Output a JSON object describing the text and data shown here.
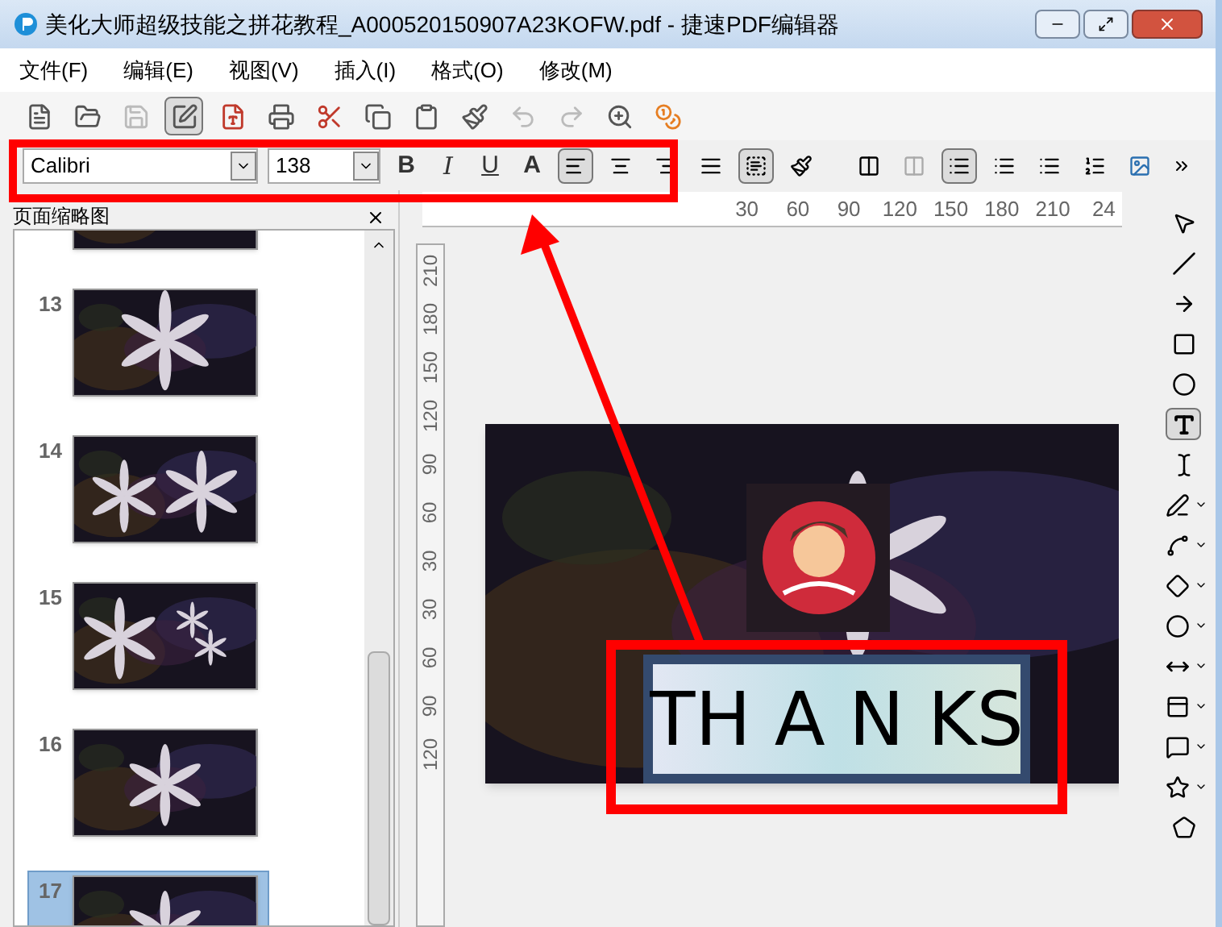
{
  "window": {
    "title": "美化大师超级技能之拼花教程_A000520150907A23KOFW.pdf - 捷速PDF编辑器"
  },
  "menu": [
    "文件(F)",
    "编辑(E)",
    "视图(V)",
    "插入(I)",
    "格式(O)",
    "修改(M)"
  ],
  "toolbar": [
    {
      "kind": "new",
      "disabled": false,
      "selected": false
    },
    {
      "kind": "open",
      "disabled": false,
      "selected": false
    },
    {
      "kind": "save",
      "disabled": true,
      "selected": false
    },
    {
      "kind": "edit",
      "disabled": false,
      "selected": true
    },
    {
      "kind": "pdf",
      "disabled": false,
      "selected": false
    },
    {
      "kind": "print",
      "disabled": false,
      "selected": false
    },
    {
      "kind": "cut",
      "disabled": false,
      "selected": false
    },
    {
      "kind": "copy",
      "disabled": false,
      "selected": false
    },
    {
      "kind": "paste",
      "disabled": false,
      "selected": false
    },
    {
      "kind": "brush",
      "disabled": false,
      "selected": false
    },
    {
      "kind": "undo",
      "disabled": true,
      "selected": false
    },
    {
      "kind": "redo",
      "disabled": true,
      "selected": false
    },
    {
      "kind": "zoom",
      "disabled": false,
      "selected": false
    },
    {
      "kind": "buy",
      "disabled": false,
      "selected": false
    }
  ],
  "format_toolbar": {
    "font": "Calibri",
    "size": "138",
    "styles": [
      "B",
      "I",
      "U",
      "A"
    ],
    "align": [
      {
        "selected": true
      },
      {
        "selected": false
      },
      {
        "selected": false
      },
      {
        "selected": false
      }
    ],
    "text_tools": [
      {
        "selected": true
      },
      {
        "selected": false
      }
    ],
    "list_tools": [
      {
        "selected": true
      },
      {
        "selected": false
      },
      {
        "selected": false
      }
    ]
  },
  "thumbnail_panel": {
    "title": "页面缩略图",
    "pages": [
      {
        "selected": false
      },
      {
        "number": "13",
        "selected": false
      },
      {
        "number": "14",
        "selected": false
      },
      {
        "number": "15",
        "selected": false
      },
      {
        "number": "16",
        "selected": false
      },
      {
        "number": "17",
        "selected": true
      }
    ]
  },
  "ruler": {
    "horizontal": [
      "30",
      "60",
      "90",
      "120",
      "150",
      "180",
      "210",
      "24"
    ],
    "vertical": [
      "210",
      "180",
      "150",
      "120",
      "90",
      "60",
      "30",
      "30",
      "60",
      "90",
      "120"
    ]
  },
  "slide": {
    "kind": "picture",
    "text": "TH A N KS"
  },
  "tools": [
    {
      "kind": "pointer",
      "selected": false
    },
    {
      "kind": "line",
      "selected": false
    },
    {
      "kind": "arrow",
      "selected": false
    },
    {
      "kind": "rect",
      "selected": false
    },
    {
      "kind": "ellipse",
      "selected": false
    },
    {
      "kind": "text",
      "selected": true
    },
    {
      "kind": "ibeam",
      "selected": false
    },
    {
      "kind": "pen",
      "selected": false
    },
    {
      "kind": "connector",
      "selected": false
    },
    {
      "kind": "diamond",
      "selected": false
    },
    {
      "kind": "circle",
      "selected": false
    },
    {
      "kind": "double-arrow",
      "selected": false
    },
    {
      "kind": "panel",
      "selected": false
    },
    {
      "kind": "callout",
      "selected": false
    },
    {
      "kind": "star",
      "selected": false
    },
    {
      "kind": "polygon",
      "selected": false
    }
  ]
}
